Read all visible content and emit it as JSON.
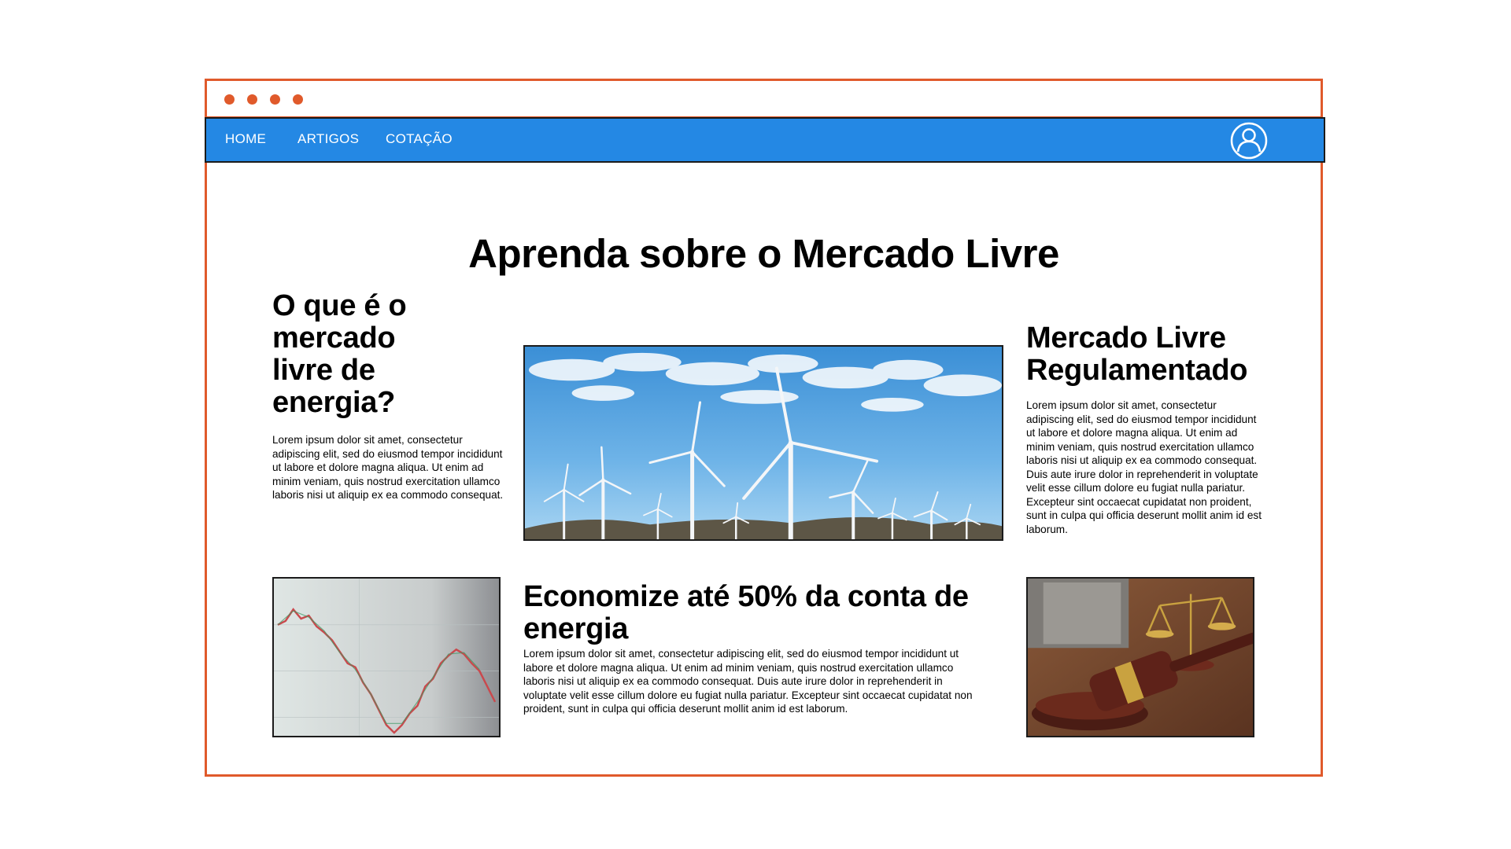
{
  "navbar": {
    "items": [
      {
        "label": "HOME"
      },
      {
        "label": "ARTIGOS"
      },
      {
        "label": "COTAÇÃO"
      }
    ],
    "user_icon": "user-circle-icon"
  },
  "colors": {
    "frame": "#e05a2b",
    "navbar": "#2488e4"
  },
  "page": {
    "title": "Aprenda sobre o Mercado Livre"
  },
  "articles": {
    "what_is": {
      "title": "O que é o mercado livre de energia?",
      "text": "Lorem ipsum dolor sit amet, consectetur adipiscing elit, sed do eiusmod tempor incididunt ut labore et dolore magna aliqua. Ut enim ad minim veniam, quis nostrud exercitation ullamco laboris nisi ut aliquip ex ea commodo consequat."
    },
    "regulated": {
      "title": "Mercado Livre Regulamentado",
      "text": "Lorem ipsum dolor sit amet, consectetur adipiscing elit, sed do eiusmod tempor incididunt ut labore et dolore magna aliqua. Ut enim ad minim veniam, quis nostrud exercitation ullamco laboris nisi ut aliquip ex ea commodo consequat. Duis aute irure dolor in reprehenderit in voluptate velit esse cillum dolore eu fugiat nulla pariatur. Excepteur sint occaecat cupidatat non proident, sunt in culpa qui officia deserunt mollit anim id est laborum."
    },
    "savings": {
      "title": "Economize até 50% da conta de energia",
      "text": "Lorem ipsum dolor sit amet, consectetur adipiscing elit, sed do eiusmod tempor incididunt ut labore et dolore magna aliqua. Ut enim ad minim veniam, quis nostrud exercitation ullamco laboris nisi ut aliquip ex ea commodo consequat. Duis aute irure dolor in reprehenderit in voluptate velit esse cillum dolore eu fugiat nulla pariatur. Excepteur sint occaecat cupidatat non proident, sunt in culpa qui officia deserunt mollit anim id est laborum."
    }
  },
  "images": {
    "wind_turbines": "wind-turbines-image",
    "stock_chart": "stock-chart-image",
    "gavel_scales": "gavel-scales-image"
  }
}
